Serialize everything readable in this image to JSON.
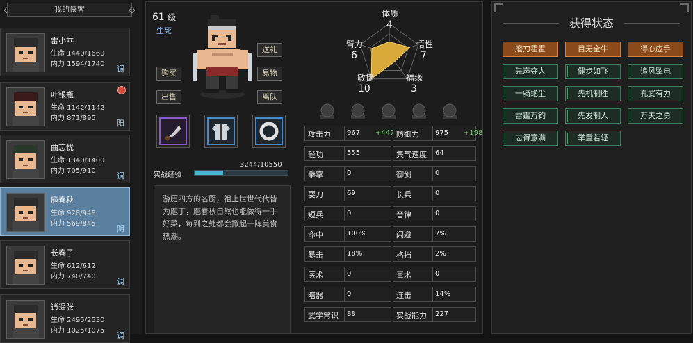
{
  "roster": {
    "title": "我的侠客",
    "characters": [
      {
        "name": "雷小乖",
        "hp": "生命 1440/1660",
        "mp": "内力 1594/1740",
        "tag": "调",
        "badge": false
      },
      {
        "name": "叶银瓶",
        "hp": "生命 1142/1142",
        "mp": "内力 871/895",
        "tag": "阳",
        "badge": true
      },
      {
        "name": "曲忘忧",
        "hp": "生命 1340/1400",
        "mp": "内力 705/910",
        "tag": "调",
        "badge": false
      },
      {
        "name": "庖春秋",
        "hp": "生命 928/948",
        "mp": "内力 569/845",
        "tag": "阴",
        "badge": false,
        "selected": true
      },
      {
        "name": "长春子",
        "hp": "生命 612/612",
        "mp": "内力 740/740",
        "tag": "调",
        "badge": false
      },
      {
        "name": "逍遥张",
        "hp": "生命 2495/2530",
        "mp": "内力 1025/1075",
        "tag": "调",
        "badge": false
      }
    ]
  },
  "hero": {
    "level": "61",
    "level_unit": "级",
    "sect": "生死",
    "buttons": {
      "gift": "送礼",
      "buy": "购买",
      "trade": "易物",
      "sell": "出售",
      "leave": "离队"
    },
    "exp_label": "实战经验",
    "exp_value": "3244/10550",
    "exp_ratio": 0.307,
    "description": "游历四方的名厨，祖上世世代代皆为庖丁，庖春秋自然也能做得一手好菜，每到之处都会掀起一阵美食热潮。"
  },
  "radar": {
    "labels": {
      "tizhi": "体质",
      "wuxing": "悟性",
      "fuyuan": "福缘",
      "minjie": "敏捷",
      "biili": "臂力"
    },
    "values": {
      "tizhi": "4",
      "wuxing": "7",
      "fuyuan": "3",
      "minjie": "10",
      "biili": "6"
    },
    "scale_max": 10
  },
  "stats": [
    {
      "k": "攻击力",
      "v": "967",
      "b": "+447"
    },
    {
      "k": "防御力",
      "v": "975",
      "b": "+198"
    },
    {
      "k": "轻功",
      "v": "555"
    },
    {
      "k": "集气速度",
      "v": "64"
    },
    {
      "k": "拳掌",
      "v": "0"
    },
    {
      "k": "御剑",
      "v": "0"
    },
    {
      "k": "耍刀",
      "v": "69"
    },
    {
      "k": "长兵",
      "v": "0"
    },
    {
      "k": "短兵",
      "v": "0"
    },
    {
      "k": "音律",
      "v": "0"
    },
    {
      "k": "命中",
      "v": "100%"
    },
    {
      "k": "闪避",
      "v": "7%"
    },
    {
      "k": "暴击",
      "v": "18%"
    },
    {
      "k": "格挡",
      "v": "2%"
    },
    {
      "k": "医术",
      "v": "0"
    },
    {
      "k": "毒术",
      "v": "0"
    },
    {
      "k": "暗器",
      "v": "0"
    },
    {
      "k": "连击",
      "v": "14%"
    },
    {
      "k": "武学常识",
      "v": "88"
    },
    {
      "k": "实战能力",
      "v": "227"
    }
  ],
  "states": {
    "title": "获得状态",
    "items": [
      {
        "label": "磨刀霍霍",
        "style": "o"
      },
      {
        "label": "目无全牛",
        "style": "o"
      },
      {
        "label": "得心应手",
        "style": "o"
      },
      {
        "label": "先声夺人",
        "style": "g"
      },
      {
        "label": "健步如飞",
        "style": "g"
      },
      {
        "label": "追风掣电",
        "style": "g"
      },
      {
        "label": "一骑绝尘",
        "style": "g"
      },
      {
        "label": "先机制胜",
        "style": "g"
      },
      {
        "label": "孔武有力",
        "style": "g"
      },
      {
        "label": "雷霆万钧",
        "style": "g"
      },
      {
        "label": "先发制人",
        "style": "g"
      },
      {
        "label": "万夫之勇",
        "style": "g"
      },
      {
        "label": "志得意满",
        "style": "g"
      },
      {
        "label": "举重若轻",
        "style": "g"
      }
    ]
  },
  "colors": {
    "accent": "#46b6d0",
    "selected": "#5a7f9f",
    "bonus": "#6fc46f",
    "orange": "#8a4a1a"
  }
}
